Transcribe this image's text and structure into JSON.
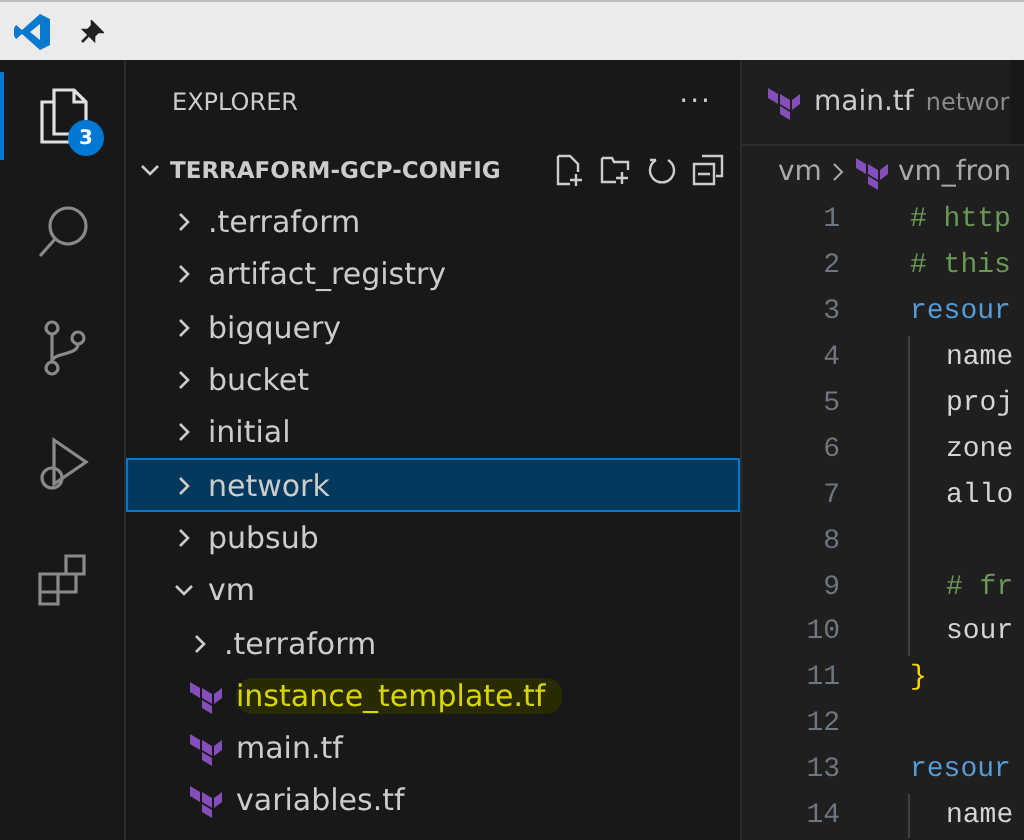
{
  "activity_bar": [
    {
      "kind": "files",
      "selected": true,
      "badge": "3"
    },
    {
      "kind": "search",
      "selected": false
    },
    {
      "kind": "source-control",
      "selected": false
    },
    {
      "kind": "run",
      "selected": false
    },
    {
      "kind": "extensions",
      "selected": false
    }
  ],
  "sidebar": {
    "title": "EXPLORER",
    "more": "···",
    "root": {
      "label": "TERRAFORM-GCP-CONFIG",
      "expanded": true,
      "children": [
        {
          "kind": "folder",
          "label": ".terraform",
          "expanded": false,
          "selected": false
        },
        {
          "kind": "folder",
          "label": "artifact_registry",
          "expanded": false,
          "selected": false
        },
        {
          "kind": "folder",
          "label": "bigquery",
          "expanded": false,
          "selected": false
        },
        {
          "kind": "folder",
          "label": "bucket",
          "expanded": false,
          "selected": false
        },
        {
          "kind": "folder",
          "label": "initial",
          "expanded": false,
          "selected": false
        },
        {
          "kind": "folder",
          "label": "network",
          "expanded": false,
          "selected": true
        },
        {
          "kind": "folder",
          "label": "pubsub",
          "expanded": false,
          "selected": false
        },
        {
          "kind": "folder",
          "label": "vm",
          "expanded": true,
          "selected": false,
          "children": [
            {
              "kind": "folder",
              "label": ".terraform",
              "expanded": false,
              "selected": false
            },
            {
              "kind": "file",
              "label": "instance_template.tf",
              "selected": false,
              "highlighted": true
            },
            {
              "kind": "file",
              "label": "main.tf",
              "selected": false,
              "highlighted": false
            },
            {
              "kind": "file",
              "label": "variables.tf",
              "selected": false,
              "highlighted": false
            }
          ]
        }
      ]
    }
  },
  "editor": {
    "tab": {
      "label": "main.tf",
      "description": "networ"
    },
    "breadcrumb": [
      "vm",
      "vm_fron"
    ],
    "lines": [
      {
        "number": "1",
        "kind": "comment",
        "text": "# http",
        "indented": false
      },
      {
        "number": "2",
        "kind": "comment",
        "text": "# this",
        "indented": false
      },
      {
        "number": "3",
        "kind": "keyword",
        "text": "resour",
        "indented": false
      },
      {
        "number": "4",
        "kind": "text",
        "text": "name",
        "indented": true
      },
      {
        "number": "5",
        "kind": "text",
        "text": "proj",
        "indented": true
      },
      {
        "number": "6",
        "kind": "text",
        "text": "zone",
        "indented": true
      },
      {
        "number": "7",
        "kind": "text",
        "text": "allo",
        "indented": true
      },
      {
        "number": "8",
        "kind": "blank",
        "indented": true
      },
      {
        "number": "9",
        "kind": "comment",
        "text": "# fr",
        "indented": true
      },
      {
        "number": "10",
        "kind": "text",
        "text": "sour",
        "indented": true
      },
      {
        "number": "11",
        "kind": "bracket",
        "text": "}",
        "indented": false
      },
      {
        "number": "12",
        "kind": "blank",
        "indented": false
      },
      {
        "number": "13",
        "kind": "keyword",
        "text": "resour",
        "indented": false
      },
      {
        "number": "14",
        "kind": "text",
        "text": "name",
        "indented": true
      }
    ]
  }
}
